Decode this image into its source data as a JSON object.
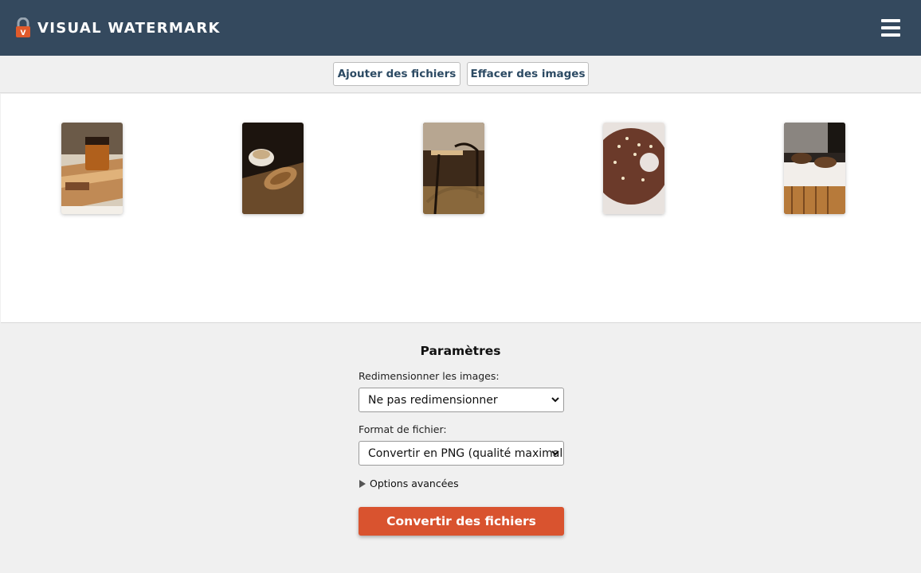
{
  "header": {
    "brand": "VISUAL WATERMARK",
    "logo_icon": "padlock-icon",
    "menu_icon": "hamburger-menu-icon",
    "background_color": "#34495e"
  },
  "toolbar": {
    "add_files_label": "Ajouter des fichiers",
    "clear_images_label": "Effacer des images"
  },
  "gallery": {
    "thumbnails": [
      {
        "subject": "iced coffee on wooden tray"
      },
      {
        "subject": "coffee cup and croissant"
      },
      {
        "subject": "cafe chairs in sunlight"
      },
      {
        "subject": "chocolate donut"
      },
      {
        "subject": "pastries on counter"
      }
    ]
  },
  "settings": {
    "title": "Paramètres",
    "resize_label": "Redimensionner les images:",
    "resize_value": "Ne pas redimensionner",
    "format_label": "Format de fichier:",
    "format_value": "Convertir en PNG (qualité maximale)",
    "advanced_label": "Options avancées",
    "convert_label": "Convertir des fichiers",
    "accent_color": "#d9532f"
  }
}
